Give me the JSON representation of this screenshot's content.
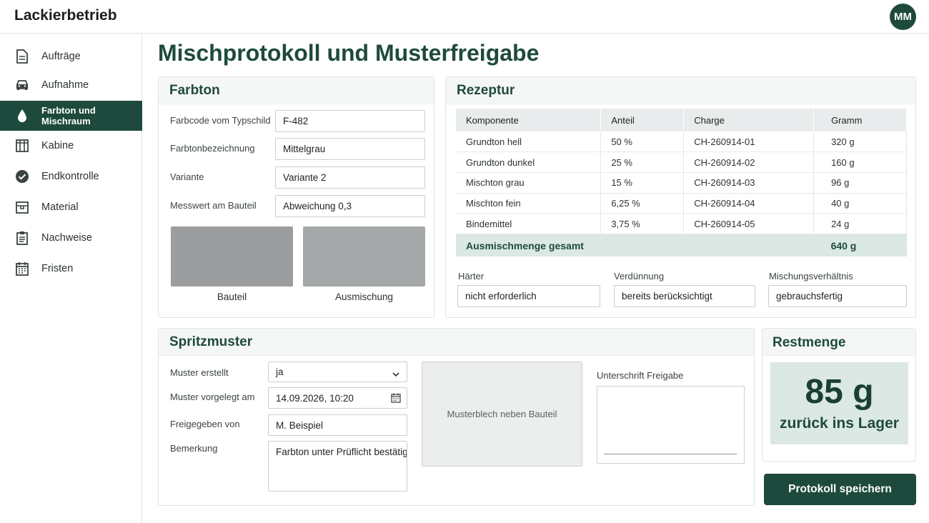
{
  "app": {
    "brand": "Lackierbetrieb",
    "avatar_initials": "MM",
    "accent": "#1e4a3d"
  },
  "sidebar": {
    "items": [
      {
        "label": "Aufträge",
        "icon": "document-icon"
      },
      {
        "label": "Aufnahme",
        "icon": "car-icon"
      },
      {
        "label": "Farbton und Mischraum",
        "icon": "paint-drop-icon",
        "active": true
      },
      {
        "label": "Kabine",
        "icon": "booth-icon"
      },
      {
        "label": "Endkontrolle",
        "icon": "check-circle-icon"
      },
      {
        "label": "Material",
        "icon": "box-icon"
      },
      {
        "label": "Nachweise",
        "icon": "clipboard-icon"
      },
      {
        "label": "Fristen",
        "icon": "calendar-icon"
      }
    ]
  },
  "page": {
    "title": "Mischprotokoll und Musterfreigabe"
  },
  "farbton": {
    "title": "Farbton",
    "fields": [
      {
        "label": "Farbcode vom Typschild",
        "value": "F-482"
      },
      {
        "label": "Farbtonbezeichnung",
        "value": "Mittelgrau"
      },
      {
        "label": "Variante",
        "value": "Variante 2"
      },
      {
        "label": "Messwert am Bauteil",
        "value": "Abweichung 0,3"
      }
    ],
    "swatches": [
      {
        "caption": "Bauteil",
        "color": "#9b9d9e"
      },
      {
        "caption": "Ausmischung",
        "color": "#a5a8a9"
      }
    ]
  },
  "rezeptur": {
    "title": "Rezeptur",
    "columns": [
      "Komponente",
      "Anteil",
      "Charge",
      "Gramm"
    ],
    "rows": [
      [
        "Grundton hell",
        "50 %",
        "CH-260914-01",
        "320 g"
      ],
      [
        "Grundton dunkel",
        "25 %",
        "CH-260914-02",
        "160 g"
      ],
      [
        "Mischton grau",
        "15 %",
        "CH-260914-03",
        "96 g"
      ],
      [
        "Mischton fein",
        "6,25 %",
        "CH-260914-04",
        "40 g"
      ],
      [
        "Bindemittel",
        "3,75 %",
        "CH-260914-05",
        "24 g"
      ]
    ],
    "total_label": "Ausmischmenge gesamt",
    "total_value": "640 g",
    "extras": [
      {
        "label": "Härter",
        "value": "nicht erforderlich"
      },
      {
        "label": "Verdünnung",
        "value": "bereits berücksichtigt"
      },
      {
        "label": "Mischungsverhältnis",
        "value": "gebrauchsfertig"
      }
    ]
  },
  "spritzmuster": {
    "title": "Spritzmuster",
    "muster_erstellt": {
      "label": "Muster erstellt",
      "value": "ja"
    },
    "vorgelegt": {
      "label": "Muster vorgelegt am",
      "value": "14.09.2026, 10:20"
    },
    "freigegeben": {
      "label": "Freigegeben von",
      "value": "M. Beispiel"
    },
    "bemerkung": {
      "label": "Bemerkung",
      "value": "Farbton unter Prüflicht bestätigt"
    },
    "photo_placeholder": "Musterblech neben Bauteil",
    "signature_label": "Unterschrift Freigabe"
  },
  "restmenge": {
    "title": "Restmenge",
    "value": "85 g",
    "subtitle": "zurück ins Lager"
  },
  "actions": {
    "save_label": "Protokoll speichern"
  }
}
